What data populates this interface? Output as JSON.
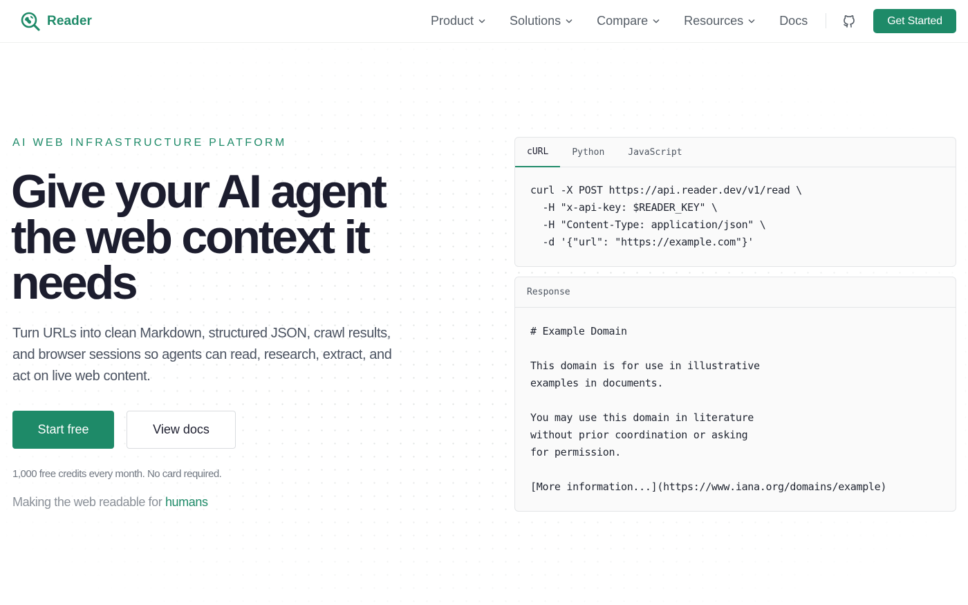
{
  "nav": {
    "brand": "Reader",
    "links": [
      {
        "label": "Product",
        "has_menu": true
      },
      {
        "label": "Solutions",
        "has_menu": true
      },
      {
        "label": "Compare",
        "has_menu": true
      },
      {
        "label": "Resources",
        "has_menu": true
      },
      {
        "label": "Docs",
        "has_menu": false
      }
    ],
    "github_icon": "github-icon",
    "cta_label": "Get Started"
  },
  "hero": {
    "eyebrow": "AI WEB INFRASTRUCTURE PLATFORM",
    "headline": "Give your AI agent the web context it needs",
    "subtext": "Turn URLs into clean Markdown, structured JSON, crawl results, and browser sessions so agents can read, research, extract, and act on live web content.",
    "primary_button": "Start free",
    "secondary_button": "View docs",
    "fineprint": "1,000 free credits every month. No card required.",
    "tagline_prefix": "Making the web readable for ",
    "tagline_accent": "humans"
  },
  "request_panel": {
    "tabs": [
      "cURL",
      "Python",
      "JavaScript"
    ],
    "active_tab": "cURL",
    "code": "curl -X POST https://api.reader.dev/v1/read \\\n  -H \"x-api-key: $READER_KEY\" \\\n  -H \"Content-Type: application/json\" \\\n  -d '{\"url\": \"https://example.com\"}'"
  },
  "response_panel": {
    "label": "Response",
    "body": "# Example Domain\n\nThis domain is for use in illustrative\nexamples in documents.\n\nYou may use this domain in literature\nwithout prior coordination or asking\nfor permission.\n\n[More information...](https://www.iana.org/domains/example)"
  },
  "colors": {
    "accent": "#1e8a68",
    "heading": "#1c1d2e",
    "body_text": "#4a5260",
    "muted_text": "#8a9098",
    "panel_bg": "#fafafa",
    "border": "#e3e5e7"
  }
}
